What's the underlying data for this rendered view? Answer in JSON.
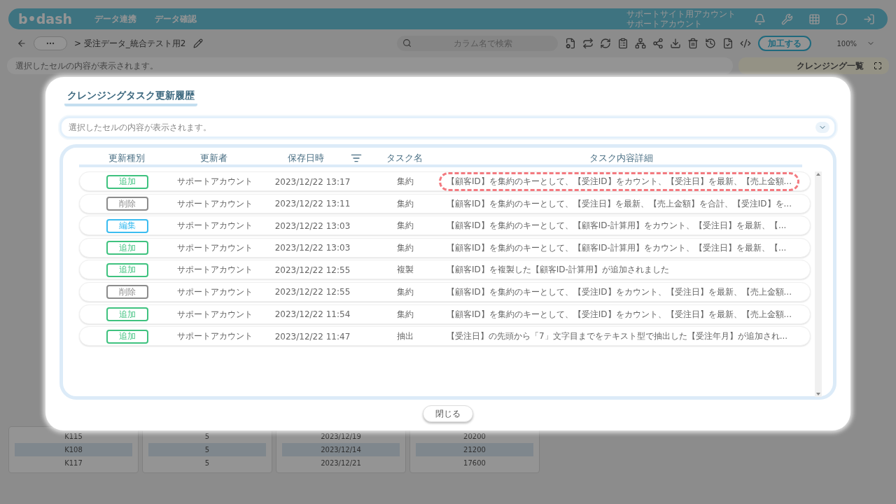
{
  "app": {
    "logo": "b•dash",
    "nav": [
      "データ連携",
      "データ確認"
    ],
    "account": [
      "サポートサイト用アカウント",
      "サポートアカウント"
    ]
  },
  "toolbar": {
    "breadcrumb": "> 受注データ_統合テスト用2",
    "search_placeholder": "カラム名で検索",
    "process_button": "加工する",
    "zoom": "100%"
  },
  "info_bar": "選択したセルの内容が表示されます。",
  "side_panel": {
    "title": "クレンジング一覧"
  },
  "background_tables": [
    {
      "rows": [
        "K115",
        "K108",
        "K117"
      ]
    },
    {
      "rows": [
        "5",
        "5",
        "5"
      ]
    },
    {
      "rows": [
        "2023/12/19",
        "2023/12/14",
        "2023/12/21"
      ]
    },
    {
      "rows": [
        "20200",
        "21200",
        "17600"
      ]
    }
  ],
  "dialog": {
    "title": "クレンジングタスク更新履歴",
    "cell_preview": {
      "placeholder": "選択したセルの内容が表示されます。"
    },
    "columns": [
      "更新種別",
      "更新者",
      "保存日時",
      "タスク名",
      "タスク内容詳細"
    ],
    "rows": [
      {
        "type": {
          "kind": "add",
          "label": "追加"
        },
        "user": "サポートアカウント",
        "saved": "2023/12/22 13:17",
        "task": "集約",
        "detail": "【顧客ID】を集約のキーとして、【受注ID】をカウント、【受注日】を最新、【売上金額...",
        "highlighted": true
      },
      {
        "type": {
          "kind": "delete",
          "label": "削除"
        },
        "user": "サポートアカウント",
        "saved": "2023/12/22 13:11",
        "task": "集約",
        "detail": "【顧客ID】を集約のキーとして、【受注日】を最新、【売上金額】を合計、【受注ID】を...",
        "highlighted": false
      },
      {
        "type": {
          "kind": "edit",
          "label": "編集"
        },
        "user": "サポートアカウント",
        "saved": "2023/12/22 13:03",
        "task": "集約",
        "detail": "【顧客ID】を集約のキーとして、【顧客ID-計算用】をカウント、【受注日】を最新、【...",
        "highlighted": false
      },
      {
        "type": {
          "kind": "add",
          "label": "追加"
        },
        "user": "サポートアカウント",
        "saved": "2023/12/22 13:03",
        "task": "集約",
        "detail": "【顧客ID】を集約のキーとして、【顧客ID-計算用】をカウント、【受注日】を最新、【...",
        "highlighted": false
      },
      {
        "type": {
          "kind": "add",
          "label": "追加"
        },
        "user": "サポートアカウント",
        "saved": "2023/12/22 12:55",
        "task": "複製",
        "detail": "【顧客ID】を複製した【顧客ID-計算用】が追加されました",
        "highlighted": false
      },
      {
        "type": {
          "kind": "delete",
          "label": "削除"
        },
        "user": "サポートアカウント",
        "saved": "2023/12/22 12:55",
        "task": "集約",
        "detail": "【顧客ID】を集約のキーとして、【受注ID】をカウント、【受注日】を最新、【売上金額...",
        "highlighted": false
      },
      {
        "type": {
          "kind": "add",
          "label": "追加"
        },
        "user": "サポートアカウント",
        "saved": "2023/12/22 11:54",
        "task": "集約",
        "detail": "【顧客ID】を集約のキーとして、【受注ID】をカウント、【受注日】を最新、【売上金額...",
        "highlighted": false
      },
      {
        "type": {
          "kind": "add",
          "label": "追加"
        },
        "user": "サポートアカウント",
        "saved": "2023/12/22 11:47",
        "task": "抽出",
        "detail": "【受注日】の先頭から「7」文字目までをテキスト型で抽出した【受注年月】が追加され...",
        "highlighted": false
      }
    ],
    "close_button": "閉じる"
  }
}
